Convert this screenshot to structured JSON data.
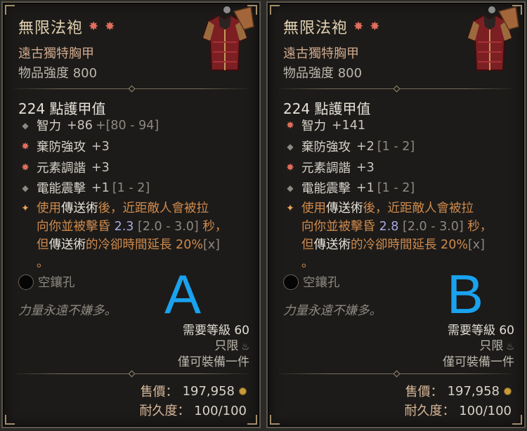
{
  "cards": [
    {
      "id": "A",
      "name": "無限法袍",
      "type": "遠古獨特胸甲",
      "power": "物品強度 800",
      "armor": "224 點護甲值",
      "affixes": [
        {
          "icon": "diamond-icon",
          "name": "智力",
          "value": "+86",
          "range": "+[80 - 94]"
        },
        {
          "icon": "greater-affix-icon",
          "name": "棄防強攻",
          "value": "+3",
          "range": ""
        },
        {
          "icon": "greater-affix-icon",
          "name": "元素調諧",
          "value": "+3",
          "range": ""
        },
        {
          "icon": "diamond-icon",
          "name": "電能震擊",
          "value": "+1",
          "range": "[1 - 2]"
        }
      ],
      "legendary": {
        "line1_a": "使用",
        "line1_b": "傳送術",
        "line1_c": "後，近距敵人會被拉",
        "line2_a": "向你並被擊昏",
        "line2_num": "2.3",
        "line2_range": "[2.0 - 3.0]",
        "line2_c": "秒，",
        "line3_a": "但",
        "line3_b": "傳送術",
        "line3_c": "的冷卻時間延長 20%",
        "line3_x": "[x]",
        "line4": "。"
      },
      "socket": "空鑲孔",
      "flavor": "力量永遠不嫌多。",
      "letter": "A",
      "req_level": "需要等級 60",
      "only": "只限",
      "equip_unique": "僅可裝備一件",
      "sell_label": "售價：",
      "sell_value": "197,958",
      "durability_label": "耐久度：",
      "durability_value": "100/100"
    },
    {
      "id": "B",
      "name": "無限法袍",
      "type": "遠古獨特胸甲",
      "power": "物品強度 800",
      "armor": "224 點護甲值",
      "affixes": [
        {
          "icon": "greater-affix-icon",
          "name": "智力",
          "value": "+141",
          "range": ""
        },
        {
          "icon": "diamond-icon",
          "name": "棄防強攻",
          "value": "+2",
          "range": "[1 - 2]"
        },
        {
          "icon": "greater-affix-icon",
          "name": "元素調諧",
          "value": "+3",
          "range": ""
        },
        {
          "icon": "diamond-icon",
          "name": "電能震擊",
          "value": "+1",
          "range": "[1 - 2]"
        }
      ],
      "legendary": {
        "line1_a": "使用",
        "line1_b": "傳送術",
        "line1_c": "後，近距敵人會被拉",
        "line2_a": "向你並被擊昏",
        "line2_num": "2.8",
        "line2_range": "[2.0 - 3.0]",
        "line2_c": "秒，",
        "line3_a": "但",
        "line3_b": "傳送術",
        "line3_c": "的冷卻時間延長 20%",
        "line3_x": "[x]",
        "line4": "。"
      },
      "socket": "空鑲孔",
      "flavor": "力量永遠不嫌多。",
      "letter": "B",
      "req_level": "需要等級 60",
      "only": "只限",
      "equip_unique": "僅可裝備一件",
      "sell_label": "售價：",
      "sell_value": "197,958",
      "durability_label": "耐久度：",
      "durability_value": "100/100"
    }
  ],
  "colors": {
    "title": "#e3d2b1",
    "unique_type": "#d1a98d",
    "legendary_text": "#d08a4c",
    "roll_value": "#a8a9e0",
    "letter": "#1aa2ee"
  }
}
